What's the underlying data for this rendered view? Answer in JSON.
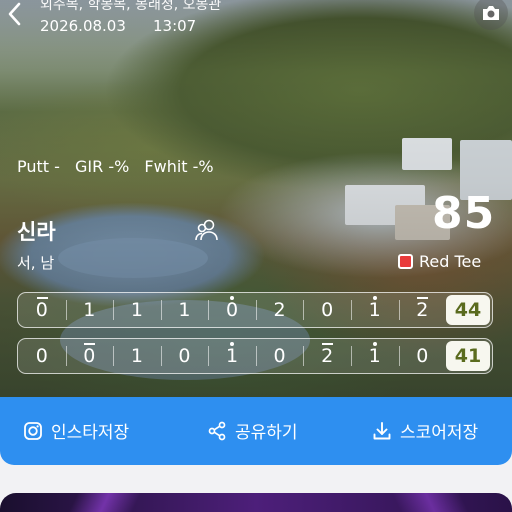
{
  "header": {
    "course_line": "외주목, 학봉목, 봉래정, 오봉관",
    "date": "2026.08.03",
    "time": "13:07"
  },
  "stats": {
    "putt": "Putt -",
    "gir": "GIR -%",
    "fwhit": "Fwhit -%"
  },
  "player": {
    "name": "신라",
    "sub": "서, 남",
    "total": "85",
    "tee": "Red Tee"
  },
  "scores": {
    "front": {
      "holes": [
        {
          "value": "0",
          "mark": "bar"
        },
        {
          "value": "1",
          "mark": "none"
        },
        {
          "value": "1",
          "mark": "none"
        },
        {
          "value": "1",
          "mark": "none"
        },
        {
          "value": "0",
          "mark": "dot"
        },
        {
          "value": "2",
          "mark": "none"
        },
        {
          "value": "0",
          "mark": "none"
        },
        {
          "value": "1",
          "mark": "dot"
        },
        {
          "value": "2",
          "mark": "bar"
        }
      ],
      "total": "44"
    },
    "back": {
      "holes": [
        {
          "value": "0",
          "mark": "none"
        },
        {
          "value": "0",
          "mark": "bar"
        },
        {
          "value": "1",
          "mark": "none"
        },
        {
          "value": "0",
          "mark": "none"
        },
        {
          "value": "1",
          "mark": "dot"
        },
        {
          "value": "0",
          "mark": "none"
        },
        {
          "value": "2",
          "mark": "bar"
        },
        {
          "value": "1",
          "mark": "dot"
        },
        {
          "value": "0",
          "mark": "none"
        }
      ],
      "total": "41"
    }
  },
  "actions": {
    "instagram": "인스타저장",
    "share": "공유하기",
    "save_score": "스코어저장"
  },
  "colors": {
    "action_bar": "#2e8ff0",
    "tee_red": "#e93b3b",
    "sum_text": "#5a6b1e"
  }
}
